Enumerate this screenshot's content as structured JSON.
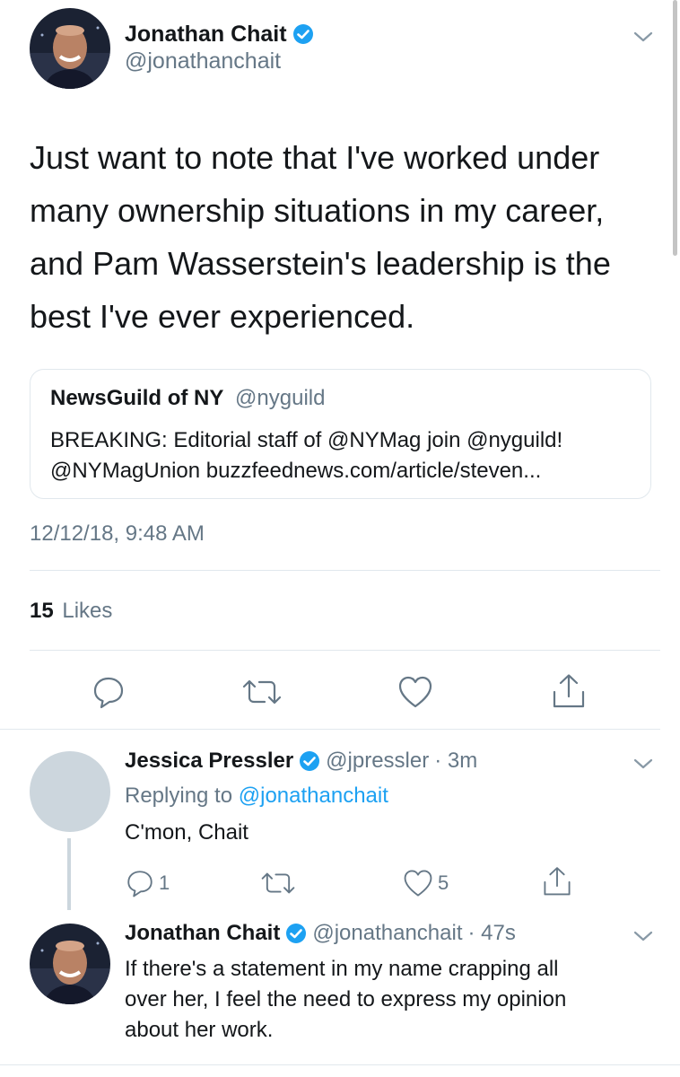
{
  "main_tweet": {
    "author": {
      "name": "Jonathan Chait",
      "handle": "@jonathanchait",
      "avatar": "avatar-jonathan-chait"
    },
    "text_lines": [
      "Just want to note that I've worked under",
      "many ownership situations in my career,",
      "and Pam Wasserstein's leadership is the",
      "best I've ever experienced."
    ],
    "quoted": {
      "name": "NewsGuild of NY",
      "handle": "@nyguild",
      "line1": "BREAKING: Editorial staff of @NYMag join @nyguild!",
      "line2": "@NYMagUnion buzzfeednews.com/article/steven..."
    },
    "timestamp": "12/12/18, 9:48 AM",
    "likes_count": "15",
    "likes_label": "Likes",
    "actions": [
      "reply-icon",
      "retweet-icon",
      "like-icon",
      "share-icon"
    ]
  },
  "replies": [
    {
      "name": "Jessica Pressler",
      "handle": "@jpressler",
      "time": "· 3m",
      "replying_prefix": "Replying to ",
      "replying_to": "@jonathanchait",
      "text_lines": [
        "C'mon, Chait"
      ],
      "reply_count": "1",
      "like_count": "5",
      "avatar": "avatar-placeholder"
    },
    {
      "name": "Jonathan Chait",
      "handle": "@jonathanchait",
      "time": "· 47s",
      "text_lines": [
        "If there's a statement in my name crapping all",
        "over her, I feel the need to express my opinion",
        "about her work."
      ],
      "avatar": "avatar-jonathan-chait"
    }
  ],
  "colors": {
    "accent": "#1da1f2",
    "verified": "#1da1f2",
    "text": "#14171a",
    "secondary": "#657786",
    "divider": "#e1e8ed",
    "placeholder_avatar": "#ccd6dd"
  }
}
